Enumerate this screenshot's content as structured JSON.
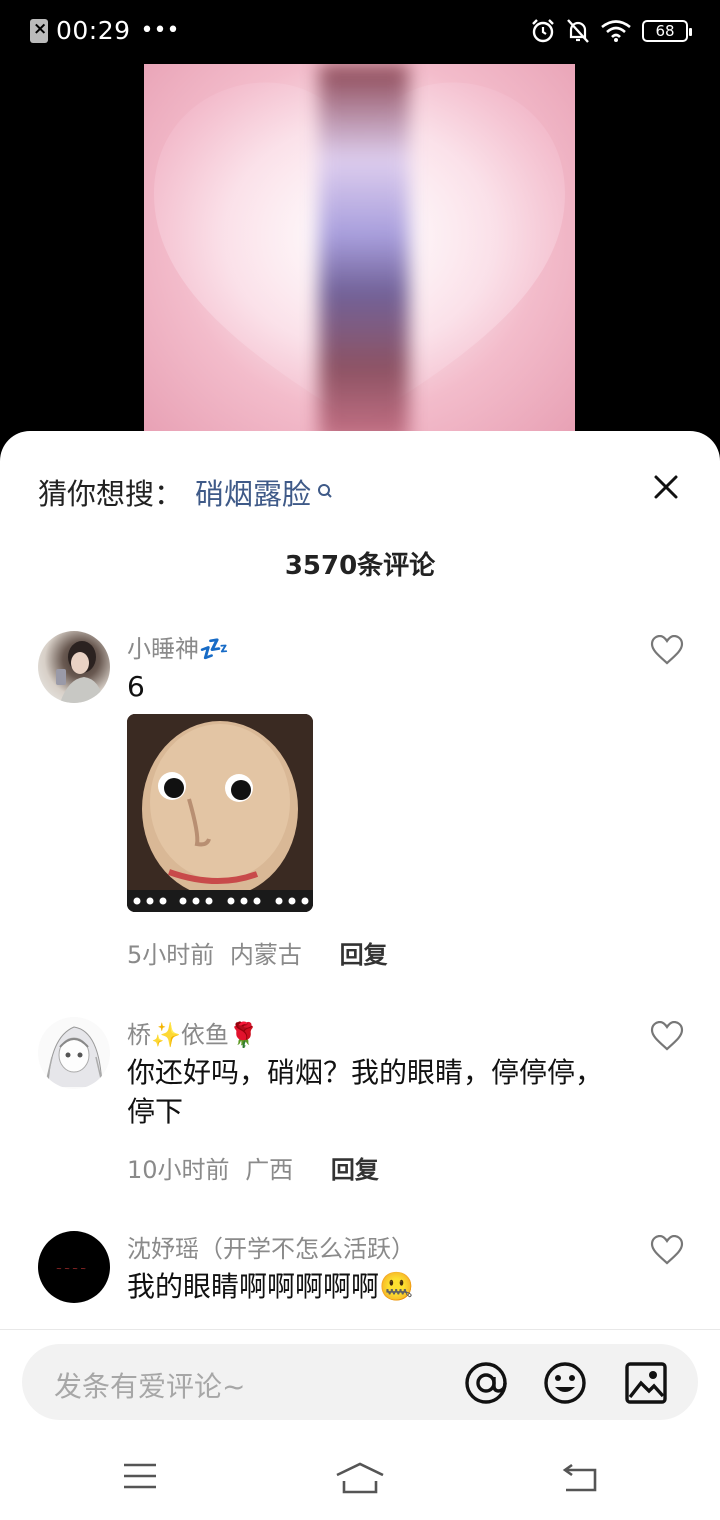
{
  "status_bar": {
    "time": "00:29",
    "dots": "•••",
    "battery": "68"
  },
  "search_suggestion": {
    "prefix": "猜你想搜：",
    "keyword": "硝烟露脸"
  },
  "comment_count": "3570条评论",
  "comments": [
    {
      "username": "小睡神",
      "username_emoji": "💤",
      "text": "6",
      "time": "5小时前",
      "location": "内蒙古",
      "reply": "回复"
    },
    {
      "username": "桥",
      "username_emoji": "✨依鱼🌹",
      "text": "你还好吗，硝烟？我的眼睛，停停停，停下",
      "time": "10小时前",
      "location": "广西",
      "reply": "回复"
    },
    {
      "username": "沈妤瑶（开学不怎么活跃）",
      "username_emoji": "",
      "text": "我的眼睛啊啊啊啊啊🤐",
      "time": "",
      "location": "",
      "reply": ""
    }
  ],
  "input": {
    "placeholder": "发条有爱评论~"
  },
  "colors": {
    "keyword": "#3f5a88",
    "meta": "#8a8a8a",
    "sheet": "#ffffff",
    "input_bg": "#f2f2f2"
  }
}
